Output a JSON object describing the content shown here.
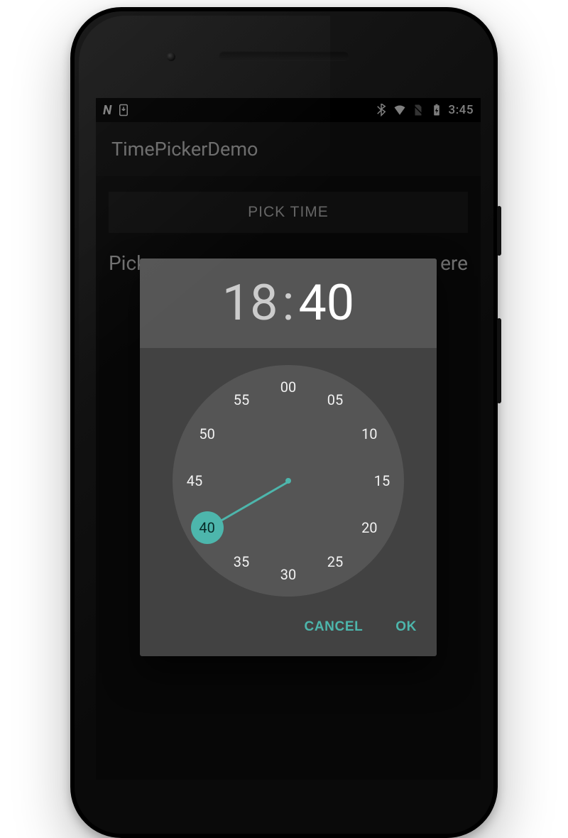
{
  "colors": {
    "accent": "#4db6ac",
    "dialog_bg": "#424242",
    "dialog_head": "#555555"
  },
  "statusbar": {
    "time": "3:45",
    "icons": [
      "n-logo",
      "download-badge",
      "bluetooth",
      "wifi",
      "no-sim",
      "battery-charging"
    ]
  },
  "app": {
    "title": "TimePickerDemo"
  },
  "main": {
    "pick_button_label": "PICK TIME",
    "result_left_fragment": "Pick",
    "result_right_fragment": "ere"
  },
  "dialog": {
    "hours": "18",
    "minutes": "40",
    "selected_minute": "40",
    "minute_marks": [
      "00",
      "05",
      "10",
      "15",
      "20",
      "25",
      "30",
      "35",
      "40",
      "45",
      "50",
      "55"
    ],
    "cancel_label": "CANCEL",
    "ok_label": "OK"
  }
}
